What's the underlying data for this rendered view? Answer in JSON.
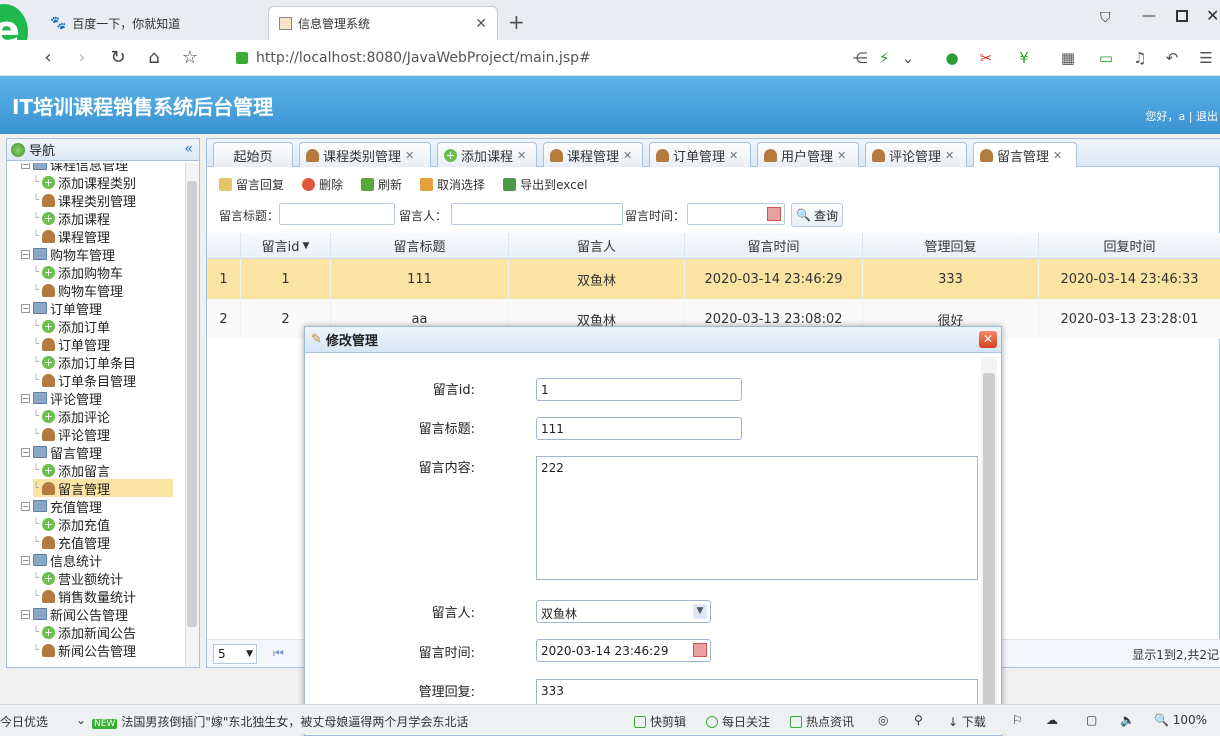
{
  "browser": {
    "tabs": [
      {
        "title": "百度一下，你就知道"
      },
      {
        "title": "信息管理系统"
      }
    ],
    "url": "http://localhost:8080/JavaWebProject/main.jsp#"
  },
  "app": {
    "title": "IT培训课程销售系统后台管理",
    "greeting": "您好，a | 退出"
  },
  "sidebar": {
    "title": "导航",
    "collapse_icon": "«",
    "tree": [
      {
        "label": "课程信息管理",
        "type": "group"
      },
      {
        "label": "添加课程类别",
        "type": "add"
      },
      {
        "label": "课程类别管理",
        "type": "user"
      },
      {
        "label": "添加课程",
        "type": "add"
      },
      {
        "label": "课程管理",
        "type": "user"
      },
      {
        "label": "购物车管理",
        "type": "group"
      },
      {
        "label": "添加购物车",
        "type": "add"
      },
      {
        "label": "购物车管理",
        "type": "user"
      },
      {
        "label": "订单管理",
        "type": "group"
      },
      {
        "label": "添加订单",
        "type": "add"
      },
      {
        "label": "订单管理",
        "type": "user"
      },
      {
        "label": "添加订单条目",
        "type": "add"
      },
      {
        "label": "订单条目管理",
        "type": "user"
      },
      {
        "label": "评论管理",
        "type": "group"
      },
      {
        "label": "添加评论",
        "type": "add"
      },
      {
        "label": "评论管理",
        "type": "user"
      },
      {
        "label": "留言管理",
        "type": "group"
      },
      {
        "label": "添加留言",
        "type": "add"
      },
      {
        "label": "留言管理",
        "type": "user",
        "selected": true
      },
      {
        "label": "充值管理",
        "type": "group"
      },
      {
        "label": "添加充值",
        "type": "add"
      },
      {
        "label": "充值管理",
        "type": "user"
      },
      {
        "label": "信息统计",
        "type": "group"
      },
      {
        "label": "营业额统计",
        "type": "add"
      },
      {
        "label": "销售数量统计",
        "type": "user"
      },
      {
        "label": "新闻公告管理",
        "type": "group"
      },
      {
        "label": "添加新闻公告",
        "type": "add"
      },
      {
        "label": "新闻公告管理",
        "type": "user"
      }
    ]
  },
  "page_tabs": [
    {
      "label": "起始页"
    },
    {
      "label": "课程类别管理"
    },
    {
      "label": "添加课程"
    },
    {
      "label": "课程管理"
    },
    {
      "label": "订单管理"
    },
    {
      "label": "用户管理"
    },
    {
      "label": "评论管理"
    },
    {
      "label": "留言管理",
      "active": true
    }
  ],
  "toolbar": {
    "reply": "留言回复",
    "delete": "删除",
    "refresh": "刷新",
    "unselect": "取消选择",
    "export": "导出到excel"
  },
  "filters": {
    "title_label": "留言标题：",
    "person_label": "留言人：",
    "time_label": "留言时间：",
    "query": "查询"
  },
  "grid": {
    "columns": [
      "留言id",
      "留言标题",
      "留言人",
      "留言时间",
      "管理回复",
      "回复时间"
    ],
    "rows": [
      {
        "num": "1",
        "id": "1",
        "title": "111",
        "person": "双鱼林",
        "time": "2020-03-14 23:46:29",
        "reply": "333",
        "reply_time": "2020-03-14 23:46:33"
      },
      {
        "num": "2",
        "id": "2",
        "title": "aa",
        "person": "双鱼林",
        "time": "2020-03-13 23:08:02",
        "reply": "很好",
        "reply_time": "2020-03-13 23:28:01"
      }
    ],
    "page_size": "5",
    "page_info": "显示1到2,共2记"
  },
  "dialog": {
    "title": "修改管理",
    "fields": {
      "id_label": "留言id:",
      "id_value": "1",
      "title_label": "留言标题:",
      "title_value": "111",
      "content_label": "留言内容:",
      "content_value": "222",
      "person_label": "留言人:",
      "person_value": "双鱼林",
      "time_label": "留言时间:",
      "time_value": "2020-03-14 23:46:29",
      "reply_label": "管理回复:",
      "reply_value": "333"
    }
  },
  "statusbar": {
    "left": "今日优选",
    "news_tag": "NEW",
    "news": "法国男孩倒插门\"嫁\"东北独生女，被丈母娘逼得两个月学会东北话",
    "kuaijian": "快剪辑",
    "meiri": "每日关注",
    "redian": "热点资讯",
    "download": "下载",
    "zoom": "100%"
  },
  "colors": {
    "header": "#3a93d2",
    "selected_row": "#fbe3a3",
    "accent": "#1fb94f"
  }
}
